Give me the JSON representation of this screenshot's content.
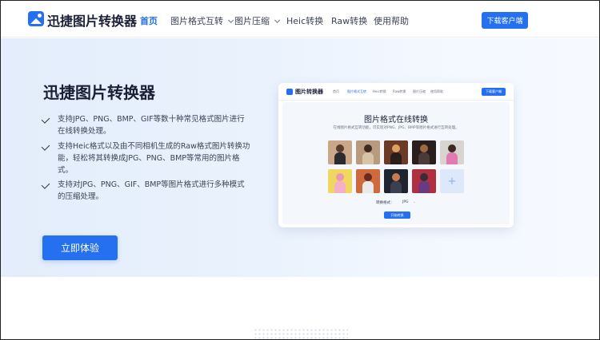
{
  "nav": {
    "brand": "迅捷图片转换器",
    "items": [
      {
        "label": "首页",
        "active": true,
        "dropdown": false
      },
      {
        "label": "图片格式互转",
        "active": false,
        "dropdown": true
      },
      {
        "label": "图片压缩",
        "active": false,
        "dropdown": true
      },
      {
        "label": "Heic转换",
        "active": false,
        "dropdown": false
      },
      {
        "label": "Raw转换",
        "active": false,
        "dropdown": false
      },
      {
        "label": "使用帮助",
        "active": false,
        "dropdown": false
      }
    ],
    "download_label": "下载客户端"
  },
  "hero": {
    "title": "迅捷图片转换器",
    "features": [
      "支持JPG、PNG、BMP、GIF等数十种常见格式图片进行在线转换处理。",
      "支持Heic格式以及由不同相机生成的Raw格式图片转换功能，轻松将其转换成JPG、PNG、BMP等常用的图片格式。",
      "支持对JPG、PNG、GIF、BMP等图片格式进行多种模式的压缩处理。"
    ],
    "cta_label": "立即体验"
  },
  "preview": {
    "brand": "图片转换器",
    "nav_items": [
      "首页",
      "图片格式互转",
      "Heic转换",
      "Raw转换",
      "图片压缩",
      "使用帮助"
    ],
    "download_label": "下载客户端",
    "title": "图片格式在线转换",
    "subtitle": "在线图片格式互转功能，可实现对PNG、JPG、BMP等图片格式进行互转处理。",
    "format_label": "转换格式：",
    "format_value": "JPG",
    "start_label": "开始转换",
    "add_symbol": "+"
  },
  "colors": {
    "accent": "#2470f0",
    "text_dark": "#1a1f36",
    "hero_bg": "#e8f0fc"
  }
}
